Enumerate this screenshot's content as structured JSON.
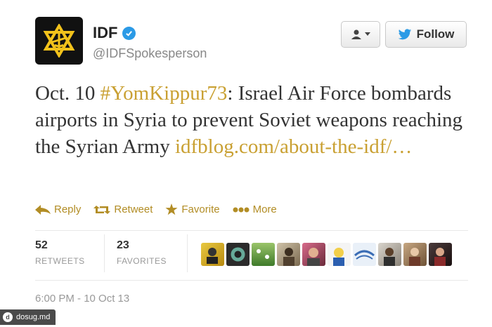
{
  "profile": {
    "name": "IDF",
    "handle": "@IDFSpokesperson",
    "verified": true,
    "avatar_icon": "idf-emblem-icon",
    "accent_color": "#f2c21b"
  },
  "buttons": {
    "user_menu_icon": "user-dropdown-icon",
    "follow_label": "Follow"
  },
  "tweet": {
    "prefix": "Oct. 10 ",
    "hashtag": "#YomKippur73",
    "body": ": Israel Air Force bombards airports in Syria to prevent Soviet weapons reaching the Syrian Army ",
    "link": "idfblog.com/about-the-idf/…",
    "link_color": "#c9a032"
  },
  "actions": [
    {
      "label": "Reply",
      "icon": "reply-icon"
    },
    {
      "label": "Retweet",
      "icon": "retweet-icon"
    },
    {
      "label": "Favorite",
      "icon": "star-icon"
    },
    {
      "label": "More",
      "icon": "more-dots-icon"
    }
  ],
  "stats": {
    "retweets": {
      "count": "52",
      "label": "RETWEETS"
    },
    "favorites": {
      "count": "23",
      "label": "FAVORITES"
    }
  },
  "timestamp": "6:00 PM - 10 Oct 13",
  "watermark": "dosug.md"
}
